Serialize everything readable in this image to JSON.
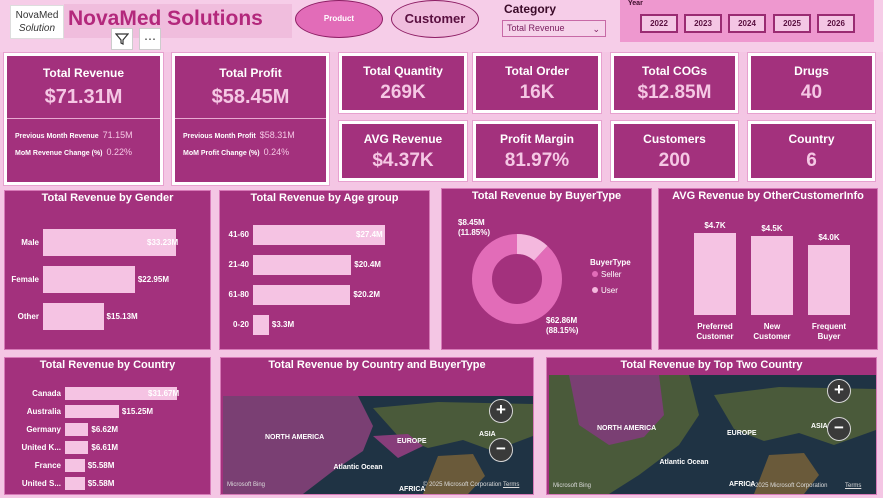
{
  "header": {
    "logo_line1": "NovaMed",
    "logo_line2": "Solution",
    "title": "NovaMed Solutions",
    "nav_product": "Product",
    "nav_customer": "Customer",
    "category_label": "Category",
    "category_value": "Total Revenue",
    "year_label": "Year",
    "years": [
      "2022",
      "2023",
      "2024",
      "2025",
      "2026"
    ],
    "filter_icon": "filter-icon",
    "more_icon": "more-options-icon"
  },
  "kpis": {
    "revenue": {
      "label": "Total Revenue",
      "value": "$71.31M",
      "prev_label": "Previous Month Revenue",
      "prev_value": "71.15M",
      "mom_label": "MoM Revenue Change (%)",
      "mom_value": "0.22%"
    },
    "profit": {
      "label": "Total Profit",
      "value": "$58.45M",
      "prev_label": "Previous Month Profit",
      "prev_value": "$58.31M",
      "mom_label": "MoM Profit Change (%)",
      "mom_value": "0.24%"
    },
    "quantity": {
      "label": "Total Quantity",
      "value": "269K"
    },
    "order": {
      "label": "Total Order",
      "value": "16K"
    },
    "cogs": {
      "label": "Total COGs",
      "value": "$12.85M"
    },
    "drugs": {
      "label": "Drugs",
      "value": "40"
    },
    "avg_revenue": {
      "label": "AVG Revenue",
      "value": "$4.37K"
    },
    "margin": {
      "label": "Profit Margin",
      "value": "81.97%"
    },
    "customers": {
      "label": "Customers",
      "value": "200"
    },
    "country": {
      "label": "Country",
      "value": "6"
    }
  },
  "colors": {
    "panel": "#a3317d",
    "bar": "#f5c3e3",
    "pie_main": "#e26cb8",
    "pie_small": "#f4b8de",
    "background": "#f4c6e4"
  },
  "chart_data": [
    {
      "type": "bar",
      "orientation": "horizontal",
      "title": "Total Revenue by Gender",
      "categories": [
        "Male",
        "Female",
        "Other"
      ],
      "values": [
        33.23,
        22.95,
        15.13
      ],
      "labels": [
        "$33.23M",
        "$22.95M",
        "$15.13M"
      ]
    },
    {
      "type": "bar",
      "orientation": "horizontal",
      "title": "Total Revenue by Age group",
      "categories": [
        "41-60",
        "21-40",
        "61-80",
        "0-20"
      ],
      "values": [
        27.4,
        20.4,
        20.2,
        3.3
      ],
      "labels": [
        "$27.4M",
        "$20.4M",
        "$20.2M",
        "$3.3M"
      ]
    },
    {
      "type": "pie",
      "style": "donut",
      "title": "Total Revenue by BuyerType",
      "legend_title": "BuyerType",
      "categories": [
        "Seller",
        "User"
      ],
      "values": [
        62.86,
        8.45
      ],
      "labels": [
        "$62.86M",
        "$8.45M"
      ],
      "percent_labels": [
        "(88.15%)",
        "(11.85%)"
      ]
    },
    {
      "type": "bar",
      "orientation": "vertical",
      "title": "AVG Revenue by OtherCustomerInfo",
      "categories": [
        "Preferred Customer",
        "New Customer",
        "Frequent Buyer"
      ],
      "category_lines": [
        [
          "Preferred",
          "Customer"
        ],
        [
          "New",
          "Customer"
        ],
        [
          "Frequent",
          "Buyer"
        ]
      ],
      "values": [
        4.7,
        4.5,
        4.0
      ],
      "labels": [
        "$4.7K",
        "$4.5K",
        "$4.0K"
      ]
    },
    {
      "type": "bar",
      "orientation": "horizontal",
      "title": "Total Revenue by Country",
      "categories": [
        "Canada",
        "Australia",
        "Germany",
        "United K...",
        "France",
        "United S..."
      ],
      "values": [
        31.67,
        15.25,
        6.62,
        6.61,
        5.58,
        5.58
      ],
      "labels": [
        "$31.67M",
        "$15.25M",
        "$6.62M",
        "$6.61M",
        "$5.58M",
        "$5.58M"
      ]
    }
  ],
  "maps": {
    "map1": {
      "title": "Total Revenue by Country and BuyerType",
      "labels": [
        "NORTH AMERICA",
        "EUROPE",
        "ASIA",
        "Atlantic Ocean",
        "AFRICA"
      ],
      "credit": "© 2025 Microsoft Corporation",
      "terms": "Terms",
      "bing": "Microsoft Bing"
    },
    "map2": {
      "title": "Total Revenue by Top Two Country",
      "labels": [
        "NORTH AMERICA",
        "EUROPE",
        "ASIA",
        "Atlantic Ocean",
        "AFRICA"
      ],
      "credit": "© 2025 Microsoft Corporation",
      "terms": "Terms",
      "bing": "Microsoft Bing"
    }
  }
}
